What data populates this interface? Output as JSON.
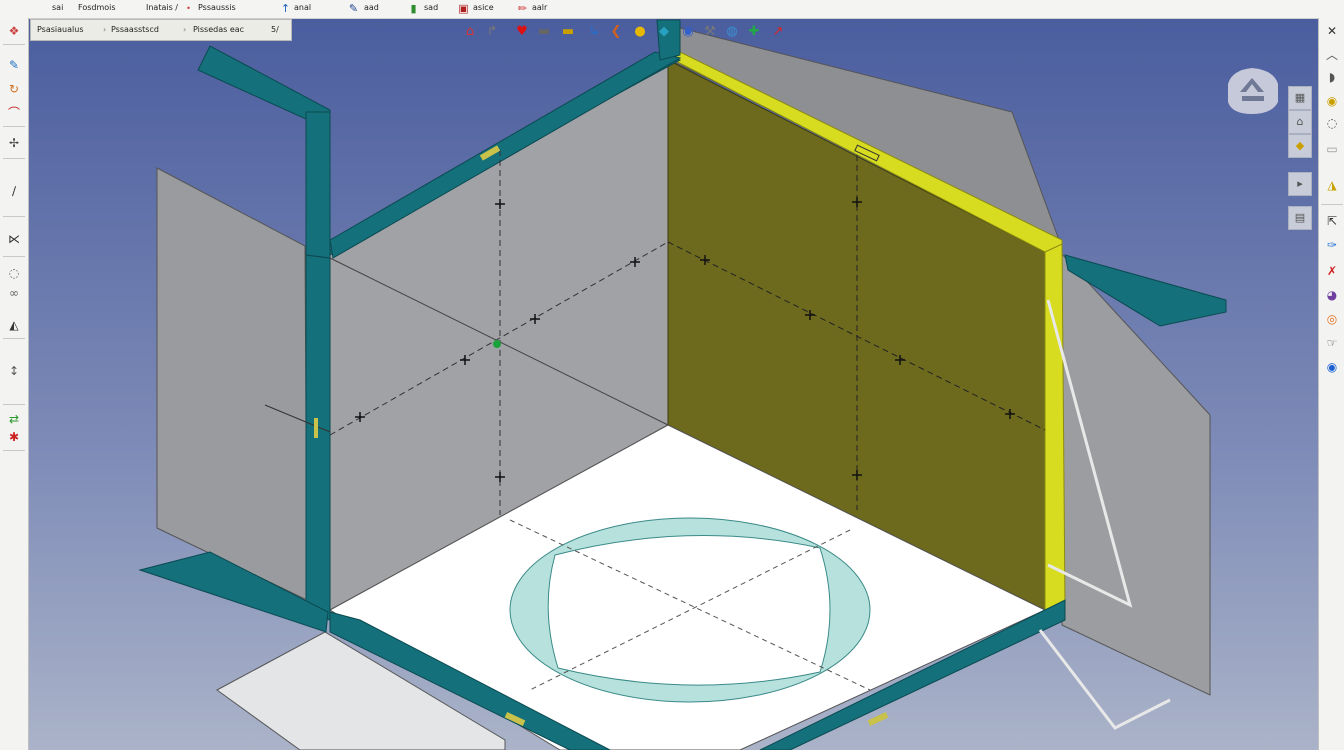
{
  "menubar": {
    "items": [
      {
        "icon": "",
        "label": "sai"
      },
      {
        "icon": "",
        "label": "Fosdmois"
      },
      {
        "icon": "",
        "label": "Inatais /"
      },
      {
        "icon": "",
        "label": "Pssaussis"
      },
      {
        "icon": "arrow-up-icon",
        "label": "anal"
      },
      {
        "icon": "pen-icon",
        "label": "aad"
      },
      {
        "icon": "bars-icon",
        "label": "sad"
      },
      {
        "icon": "book-icon",
        "label": "asice"
      },
      {
        "icon": "pencil-icon",
        "label": "aalr"
      }
    ]
  },
  "breadcrumb": {
    "items": [
      "Psasiaualus",
      "Pssaasstscd",
      "Pissedas eac",
      "5/"
    ]
  },
  "left_toolbar": {
    "tools": [
      "app-logo-icon",
      "sketch-pencil-icon",
      "rotate-icon",
      "arc-icon",
      "dimension-icon",
      "line-icon",
      "measure-icon",
      "constraint-icon",
      "clip-icon",
      "trim-icon",
      "axis-arrow-icon",
      "green-arrows-icon",
      "red-green-icon"
    ]
  },
  "command_toolbar": {
    "tools": [
      "home-icon",
      "orbit-icon",
      "heart-marker-icon",
      "flat-plate-icon",
      "yellow-plate-icon",
      "blue-bracket-icon",
      "bend-icon",
      "yellow-circle-icon",
      "cyan-sheet-icon",
      "globe-icon",
      "wrench-icon",
      "sphere-icon",
      "green-arrow-icon",
      "red-arrow-icon"
    ]
  },
  "view_palette": {
    "tools": [
      "sheet-view-icon",
      "fold-view-icon",
      "section-view-icon",
      "flatten-view-icon",
      "page-view-icon",
      "shade-view-icon"
    ]
  },
  "right_toolbar": {
    "tools": [
      "close-icon",
      "collapse-icon",
      "help-icon",
      "circle-info-icon",
      "open-icon",
      "panel-icon",
      "layer-icon",
      "select-icon",
      "blue-tool-icon",
      "red-tool-icon",
      "color-sphere-icon",
      "orange-ring-icon",
      "cursor-icon",
      "blue-globe-icon"
    ]
  },
  "viewcube": {
    "label": "viewcube-home-icon"
  },
  "colors": {
    "viewport_top": "#4a5d9e",
    "viewport_bottom": "#aab3c8",
    "flange_teal": "#14707a",
    "selected_face": "#6d6a1e",
    "selected_edge": "#d8dc20",
    "side_face": "#a1a2a5",
    "floor_face": "#ffffff",
    "circle_ring": "#b7e1dd"
  }
}
